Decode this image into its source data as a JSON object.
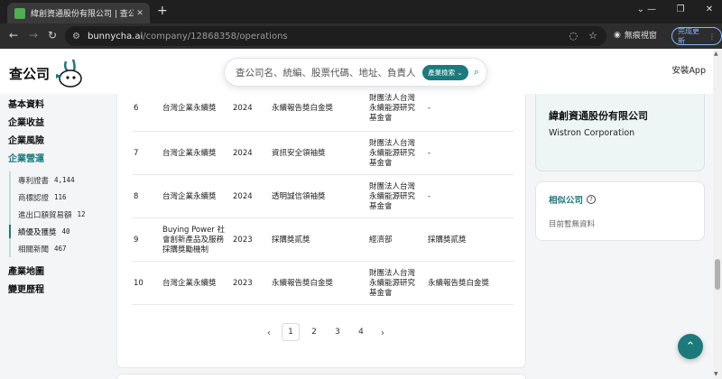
{
  "browser": {
    "tab_title": "緯創資通股份有限公司 | 查公司",
    "url_host": "bunnycha.ai",
    "url_path": "/company/12868358/operations",
    "incognito_label": "無痕視窗",
    "update_label": "完成更新"
  },
  "header": {
    "logo_text": "查公司",
    "search_placeholder": "查公司名、統編、股票代碼、地址、負責人",
    "search_chip": "產業檢索 ⌄",
    "install_label": "安裝App"
  },
  "sidebar": {
    "top_items": [
      {
        "label": "基本資料"
      },
      {
        "label": "企業收益"
      },
      {
        "label": "企業風險"
      },
      {
        "label": "企業營運"
      }
    ],
    "sub_items": [
      {
        "label": "專利證書",
        "count": "4,144"
      },
      {
        "label": "商標認證",
        "count": "116"
      },
      {
        "label": "進出口額貿易額",
        "count": "12"
      },
      {
        "label": "績優及獲獎",
        "count": "40"
      },
      {
        "label": "相關新聞",
        "count": "467"
      }
    ],
    "bottom_items": [
      {
        "label": "產業地圖"
      },
      {
        "label": "變更歷程"
      }
    ]
  },
  "table": {
    "rows": [
      {
        "no": "6",
        "source": "台灣企業永續獎",
        "year": "2024",
        "award": "永續報告獎白金獎",
        "org": "財團法人台灣永續能源研究基金會",
        "note": "-"
      },
      {
        "no": "7",
        "source": "台灣企業永續獎",
        "year": "2024",
        "award": "資訊安全領袖獎",
        "org": "財團法人台灣永續能源研究基金會",
        "note": "-"
      },
      {
        "no": "8",
        "source": "台灣企業永續獎",
        "year": "2024",
        "award": "透明誠信領袖獎",
        "org": "財團法人台灣永續能源研究基金會",
        "note": "-"
      },
      {
        "no": "9",
        "source": "Buying Power 社會創新產品及服務採購獎勵機制",
        "year": "2023",
        "award": "採購獎貳獎",
        "org": "經濟部",
        "note": "採購獎貳獎"
      },
      {
        "no": "10",
        "source": "台灣企業永續獎",
        "year": "2023",
        "award": "永續報告獎白金獎",
        "org": "財團法人台灣永續能源研究基金會",
        "note": "永續報告獎白金獎"
      }
    ]
  },
  "pagination": {
    "prev": "‹",
    "pages": [
      "1",
      "2",
      "3",
      "4"
    ],
    "next": "›"
  },
  "company_card": {
    "name_zh": "緯創資通股份有限公司",
    "name_en": "Wistron Corporation"
  },
  "similar_card": {
    "title": "相似公司",
    "empty_text": "目前暫無資料"
  },
  "colors": {
    "accent": "#1c7a7c"
  }
}
